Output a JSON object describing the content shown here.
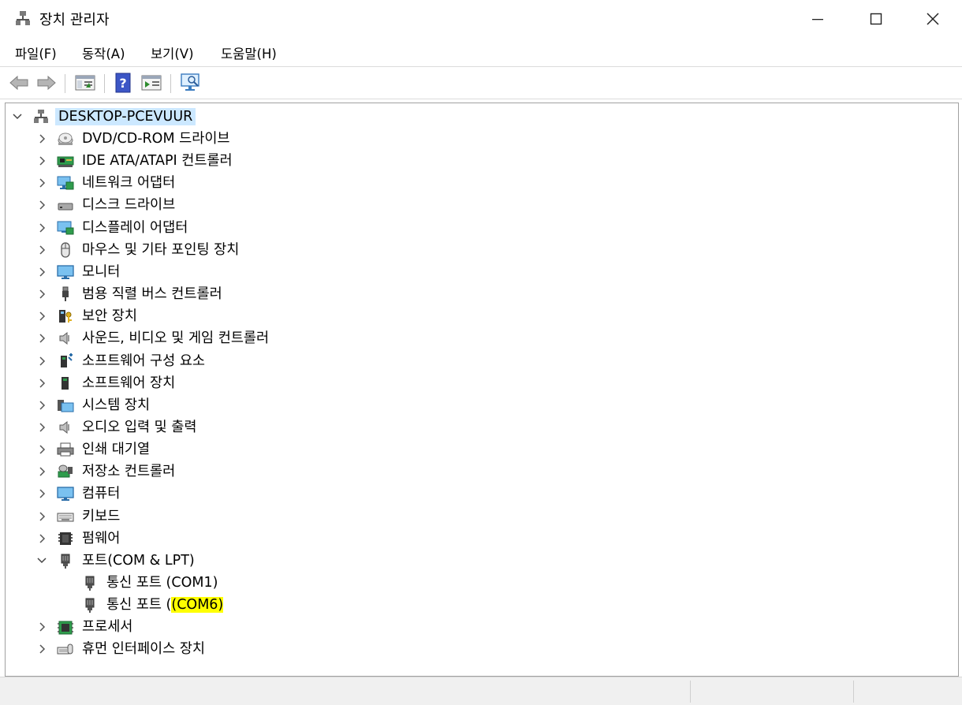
{
  "window": {
    "title": "장치 관리자",
    "minimize": "—",
    "maximize": "☐",
    "close": "✕"
  },
  "menu": [
    {
      "label": "파일(F)"
    },
    {
      "label": "동작(A)"
    },
    {
      "label": "보기(V)"
    },
    {
      "label": "도움말(H)"
    }
  ],
  "toolbar": {
    "buttons": [
      "back-icon",
      "forward-icon",
      "properties-pane-icon",
      "help-icon",
      "run-icon",
      "scan-hardware-icon"
    ]
  },
  "tree": {
    "root": {
      "label": "DESKTOP-PCEVUUR",
      "expanded": true
    },
    "categories": [
      {
        "label": "DVD/CD-ROM 드라이브",
        "icon": "dvd-drive-icon"
      },
      {
        "label": "IDE ATA/ATAPI 컨트롤러",
        "icon": "ide-controller-icon"
      },
      {
        "label": "네트워크 어댑터",
        "icon": "network-adapter-icon"
      },
      {
        "label": "디스크 드라이브",
        "icon": "disk-drive-icon"
      },
      {
        "label": "디스플레이 어댑터",
        "icon": "display-adapter-icon"
      },
      {
        "label": "마우스 및 기타 포인팅 장치",
        "icon": "mouse-icon"
      },
      {
        "label": "모니터",
        "icon": "monitor-icon"
      },
      {
        "label": "범용 직렬 버스 컨트롤러",
        "icon": "usb-icon"
      },
      {
        "label": "보안 장치",
        "icon": "security-device-icon"
      },
      {
        "label": "사운드, 비디오 및 게임 컨트롤러",
        "icon": "speaker-icon"
      },
      {
        "label": "소프트웨어 구성 요소",
        "icon": "software-component-icon"
      },
      {
        "label": "소프트웨어 장치",
        "icon": "software-device-icon"
      },
      {
        "label": "시스템 장치",
        "icon": "system-device-icon"
      },
      {
        "label": "오디오 입력 및 출력",
        "icon": "speaker-icon"
      },
      {
        "label": "인쇄 대기열",
        "icon": "printer-icon"
      },
      {
        "label": "저장소 컨트롤러",
        "icon": "storage-controller-icon"
      },
      {
        "label": "컴퓨터",
        "icon": "computer-icon"
      },
      {
        "label": "키보드",
        "icon": "keyboard-icon"
      },
      {
        "label": "펌웨어",
        "icon": "firmware-icon"
      },
      {
        "label": "포트(COM & LPT)",
        "icon": "port-icon",
        "expanded": true
      },
      {
        "label": "프로세서",
        "icon": "processor-icon"
      },
      {
        "label": "휴먼 인터페이스 장치",
        "icon": "hid-icon"
      }
    ],
    "ports_children": [
      {
        "label_prefix": "통신 포트",
        "label_suffix": "(COM1)",
        "highlight": false
      },
      {
        "label_prefix": "통신 포트",
        "label_suffix_plain": "(",
        "label_suffix_hl": "(COM6)",
        "highlight": true
      }
    ]
  },
  "colors": {
    "selection": "#cce8ff",
    "highlight": "#ffff00",
    "chevron": "#555555"
  }
}
